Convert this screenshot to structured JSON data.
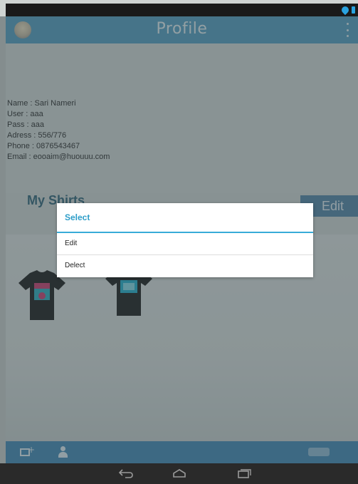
{
  "action_bar": {
    "title": "Profile"
  },
  "profile": {
    "name": "Name : Sari Nameri",
    "user": "User : aaa",
    "pass": "Pass : aaa",
    "address": "Adress : 556/776",
    "phone": "Phone : 0876543467",
    "email": "Email : eooaim@huouuu.com"
  },
  "shirts_section": {
    "title": "My Shirts",
    "edit_label": "Edit"
  },
  "dialog": {
    "title": "Select",
    "items": [
      {
        "label": "Edit"
      },
      {
        "label": "Delect"
      }
    ]
  },
  "icons": {
    "app": "app-icon",
    "overflow": "overflow-icon",
    "add_photo": "add-photo-icon",
    "person": "person-icon",
    "back": "back-icon",
    "home": "home-icon",
    "recents": "recents-icon"
  },
  "colors": {
    "action_bar": "#5fa6c8",
    "accent": "#38abd8",
    "edit_button": "#5f8fb0",
    "bottom_bar": "#4f93bd"
  }
}
